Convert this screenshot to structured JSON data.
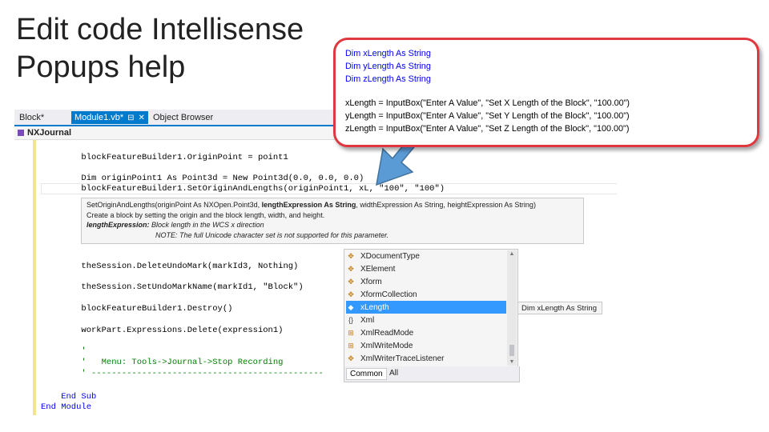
{
  "title_lines": [
    "Edit code Intellisense",
    "Popups help"
  ],
  "ide": {
    "tabs": [
      {
        "label": "Block*"
      },
      {
        "label": "Module1.vb*",
        "active": true,
        "pin": "⊟",
        "close": "✕"
      },
      {
        "label": "Object Browser"
      }
    ],
    "nav_label": "NXJournal"
  },
  "code_lines": [
    "        blockFeatureBuilder1.OriginPoint = point1",
    "        Dim originPoint1 As Point3d = New Point3d(0.0, 0.0, 0.0)",
    "        blockFeatureBuilder1.SetOriginAndLengths(originPoint1, xL, \"100\", \"100\")",
    "        theSession.DeleteUndoMark(markId3, Nothing)",
    "        theSession.SetUndoMarkName(markId1, \"Block\")",
    "        blockFeatureBuilder1.Destroy()",
    "        workPart.Expressions.Delete(expression1)",
    "        '",
    "        '   Menu: Tools->Journal->Stop Recording",
    "        ' ----------------------------------------------",
    "    End Sub",
    "End Module"
  ],
  "tooltip": {
    "signature_pre": "SetOriginAndLengths(originPoint As NXOpen.Point3d, ",
    "signature_bold": "lengthExpression As String",
    "signature_post": ", widthExpression As String, heightExpression As String)",
    "description": "Create a block by setting the origin and the block length, width, and height.",
    "param_name": "lengthExpression:",
    "param_desc": " Block length in the WCS x direction",
    "note": "NOTE: The full Unicode character set is not supported for this parameter."
  },
  "completion": {
    "items": [
      {
        "label": "XDocumentType",
        "icon": "class-icon"
      },
      {
        "label": "XElement",
        "icon": "class-icon"
      },
      {
        "label": "Xform",
        "icon": "class-icon"
      },
      {
        "label": "XformCollection",
        "icon": "class-icon"
      },
      {
        "label": "xLength",
        "icon": "variable-icon",
        "selected": true
      },
      {
        "label": "Xml",
        "icon": "namespace-icon"
      },
      {
        "label": "XmlReadMode",
        "icon": "enum-icon"
      },
      {
        "label": "XmlWriteMode",
        "icon": "enum-icon"
      },
      {
        "label": "XmlWriterTraceListener",
        "icon": "class-icon"
      }
    ],
    "tab_common": "Common",
    "tab_all": "All",
    "selected_description": "Dim xLength As String"
  },
  "callout_lines": {
    "l1": "Dim xLength As String",
    "l2": "Dim yLength As String",
    "l3": "Dim zLength As String",
    "l4": "xLength = InputBox(\"Enter A Value\", \"Set X Length of the Block\", \"100.00\")",
    "l5": "yLength = InputBox(\"Enter A Value\", \"Set Y Length of the Block\", \"100.00\")",
    "l6": "zLength = InputBox(\"Enter A Value\", \"Set Z Length of the Block\", \"100.00\")"
  },
  "colors": {
    "accent": "#007acc",
    "callout_border": "#e0383f",
    "arrow": "#5b9bd5",
    "selection": "#3399ff"
  }
}
